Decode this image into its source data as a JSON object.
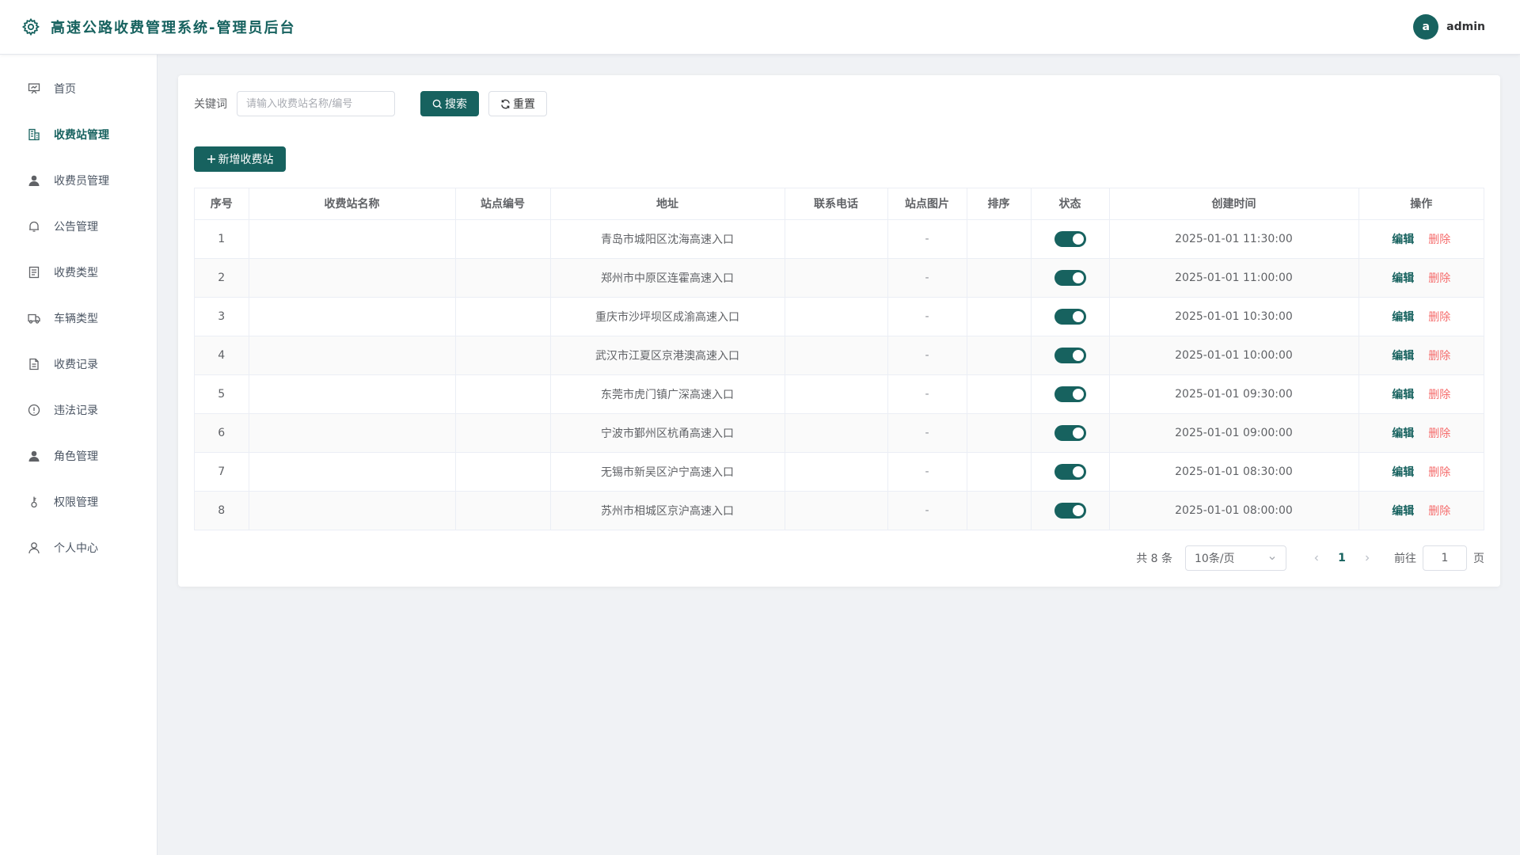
{
  "header": {
    "title": "高速公路收费管理系统-管理员后台",
    "avatar_letter": "a",
    "username": "admin"
  },
  "sidebar": {
    "items": [
      {
        "label": "首页",
        "icon": "presentation-board-icon",
        "active": false
      },
      {
        "label": "收费站管理",
        "icon": "office-building-icon",
        "active": true
      },
      {
        "label": "收费员管理",
        "icon": "user-filled-icon",
        "active": false
      },
      {
        "label": "公告管理",
        "icon": "bell-icon",
        "active": false
      },
      {
        "label": "收费类型",
        "icon": "document-list-icon",
        "active": false
      },
      {
        "label": "车辆类型",
        "icon": "truck-icon",
        "active": false
      },
      {
        "label": "收费记录",
        "icon": "document-icon",
        "active": false
      },
      {
        "label": "违法记录",
        "icon": "warning-circle-icon",
        "active": false
      },
      {
        "label": "角色管理",
        "icon": "user-role-icon",
        "active": false
      },
      {
        "label": "权限管理",
        "icon": "key-icon",
        "active": false
      },
      {
        "label": "个人中心",
        "icon": "user-outline-icon",
        "active": false
      }
    ]
  },
  "search": {
    "label": "关键词",
    "placeholder": "请输入收费站名称/编号",
    "value": "",
    "search_button": "搜索",
    "reset_button": "重置"
  },
  "toolbar": {
    "add_button": "新增收费站"
  },
  "table": {
    "columns": [
      "序号",
      "收费站名称",
      "站点编号",
      "地址",
      "联系电话",
      "站点图片",
      "排序",
      "状态",
      "创建时间",
      "操作"
    ],
    "rows": [
      {
        "index": "1",
        "name": "",
        "code": "",
        "address": "青岛市城阳区沈海高速入口",
        "phone": "",
        "image": "-",
        "sort": "",
        "status": true,
        "created": "2025-01-01 11:30:00"
      },
      {
        "index": "2",
        "name": "",
        "code": "",
        "address": "郑州市中原区连霍高速入口",
        "phone": "",
        "image": "-",
        "sort": "",
        "status": true,
        "created": "2025-01-01 11:00:00"
      },
      {
        "index": "3",
        "name": "",
        "code": "",
        "address": "重庆市沙坪坝区成渝高速入口",
        "phone": "",
        "image": "-",
        "sort": "",
        "status": true,
        "created": "2025-01-01 10:30:00"
      },
      {
        "index": "4",
        "name": "",
        "code": "",
        "address": "武汉市江夏区京港澳高速入口",
        "phone": "",
        "image": "-",
        "sort": "",
        "status": true,
        "created": "2025-01-01 10:00:00"
      },
      {
        "index": "5",
        "name": "",
        "code": "",
        "address": "东莞市虎门镇广深高速入口",
        "phone": "",
        "image": "-",
        "sort": "",
        "status": true,
        "created": "2025-01-01 09:30:00"
      },
      {
        "index": "6",
        "name": "",
        "code": "",
        "address": "宁波市鄞州区杭甬高速入口",
        "phone": "",
        "image": "-",
        "sort": "",
        "status": true,
        "created": "2025-01-01 09:00:00"
      },
      {
        "index": "7",
        "name": "",
        "code": "",
        "address": "无锡市新吴区沪宁高速入口",
        "phone": "",
        "image": "-",
        "sort": "",
        "status": true,
        "created": "2025-01-01 08:30:00"
      },
      {
        "index": "8",
        "name": "",
        "code": "",
        "address": "苏州市相城区京沪高速入口",
        "phone": "",
        "image": "-",
        "sort": "",
        "status": true,
        "created": "2025-01-01 08:00:00"
      }
    ],
    "edit_label": "编辑",
    "delete_label": "删除"
  },
  "pagination": {
    "total_text": "共 8 条",
    "page_size": "10条/页",
    "current_page": "1",
    "goto_label": "前往",
    "goto_value": "1",
    "goto_suffix": "页"
  },
  "colors": {
    "primary": "#17625f",
    "danger": "#f56c6c"
  }
}
